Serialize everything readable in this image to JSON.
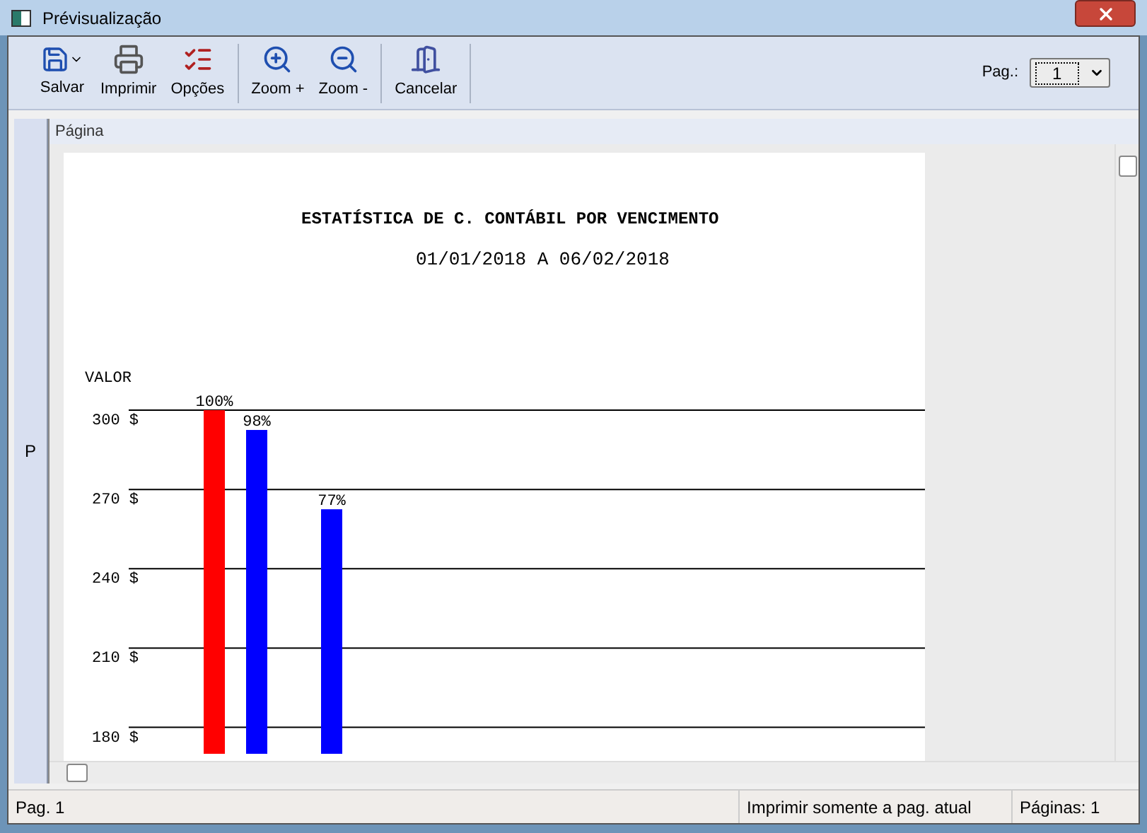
{
  "window": {
    "title": "Prévisualização"
  },
  "toolbar": {
    "buttons": [
      {
        "label": "Salvar",
        "kind": "save"
      },
      {
        "label": "Imprimir",
        "kind": "print"
      },
      {
        "label": "Opções",
        "kind": "options"
      },
      {
        "label": "Zoom +",
        "kind": "zoomin"
      },
      {
        "label": "Zoom -",
        "kind": "zoomout"
      },
      {
        "label": "Cancelar",
        "kind": "cancel"
      }
    ],
    "page_label": "Pag.:",
    "page_select": {
      "value": "1"
    }
  },
  "side_panel": {
    "label": "P"
  },
  "panel": {
    "title": "Página"
  },
  "report": {
    "title": "ESTATÍSTICA DE C. CONTÁBIL POR VENCIMENTO",
    "subtitle": "01/01/2018 A 06/02/2018",
    "chart_data": {
      "type": "bar",
      "ylabel": "VALOR",
      "grid": true,
      "ylim": [
        170,
        300
      ],
      "yticks": [
        {
          "value": 300,
          "label": "300 $"
        },
        {
          "value": 270,
          "label": "270 $"
        },
        {
          "value": 240,
          "label": "240 $"
        },
        {
          "value": 210,
          "label": "210 $"
        },
        {
          "value": 180,
          "label": "180 $"
        }
      ],
      "values": [
        300,
        292.5,
        262.5
      ],
      "colors": [
        "#ff0000",
        "#0000ff",
        "#0000ff"
      ],
      "annotations": [
        "100%",
        "98%",
        "77%"
      ]
    }
  },
  "status_bar": {
    "page": "Pag. 1",
    "print_mode": "Imprimir somente a pag. atual",
    "pages": "Páginas: 1"
  }
}
